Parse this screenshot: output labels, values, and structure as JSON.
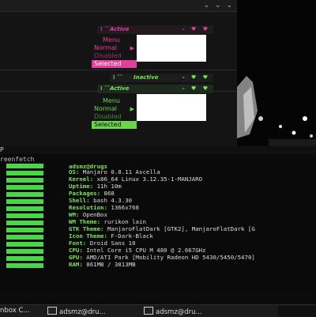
{
  "top_controls": "⌄ ⌄ ⌄",
  "window_preview_1": {
    "titlebar": {
      "dots": "⁞ ˇˇ",
      "title": "Active",
      "buttons": "- ♥ ♥"
    },
    "menu": {
      "header": "Menu",
      "items": [
        "Normal",
        "Disabled",
        "Selected"
      ]
    },
    "accent": "#e0409a"
  },
  "window_preview_2": {
    "inactive_titlebar": {
      "dots": "⁞ ˇˇ",
      "title": "Inactive",
      "buttons": "- ♥ ♥"
    },
    "titlebar": {
      "dots": "⁞ ˇˇ",
      "title": "Active",
      "buttons": "- ♥ ♥"
    },
    "menu": {
      "header": "Menu",
      "items": [
        "Normal",
        "Disabled",
        "Selected"
      ]
    },
    "accent": "#6bd64a"
  },
  "terminal": {
    "title": "P",
    "command": "reenfetch",
    "user_host": "adsmz@drugs",
    "info": [
      {
        "key": "OS:",
        "value": " Manjaro 0.8.11 Ascella"
      },
      {
        "key": "Kernel:",
        "value": " x86_64 Linux 3.12.35-1-MANJARO"
      },
      {
        "key": "Uptime:",
        "value": " 11h 10m"
      },
      {
        "key": "Packages:",
        "value": " 868"
      },
      {
        "key": "Shell:",
        "value": " bash 4.3.30"
      },
      {
        "key": "Resolution:",
        "value": " 1366x768"
      },
      {
        "key": "WM:",
        "value": " OpenBox"
      },
      {
        "key": "WM Theme:",
        "value": " rurikon lain"
      },
      {
        "key": "GTK Theme:",
        "value": " ManjaroFlatDark [GTK2], ManjaroFlatDark [G"
      },
      {
        "key": "Icon Theme:",
        "value": " F-Dark-Black"
      },
      {
        "key": "Font:",
        "value": " Droid Sans 10"
      },
      {
        "key": "CPU:",
        "value": " Intel Core i5 CPU M 480 @ 2.667GHz"
      },
      {
        "key": "GPU:",
        "value": " AMD/ATI Park [Mobility Radeon HD 5430/5450/5470]"
      },
      {
        "key": "RAM:",
        "value": " 861MB / 3813MB"
      }
    ],
    "bar_color": "#49d649"
  },
  "taskbar": {
    "items": [
      {
        "label": "nbox C..."
      },
      {
        "label": "adsmz@dru..."
      },
      {
        "label": "adsmz@dru..."
      }
    ]
  }
}
